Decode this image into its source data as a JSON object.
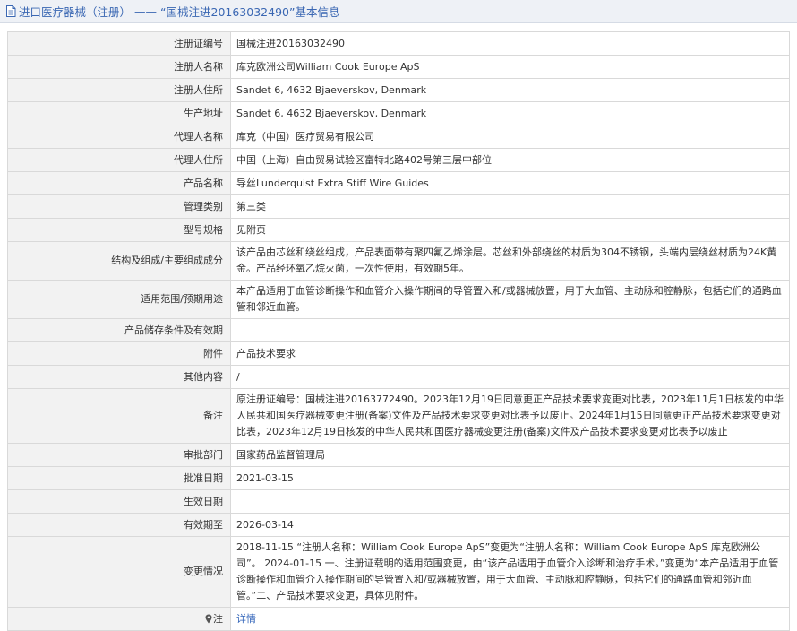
{
  "header": {
    "category": "进口医疗器械（注册）",
    "separator": "——",
    "subject": "“国械注进20163032490”基本信息"
  },
  "rows": [
    {
      "label": "注册证编号",
      "value": "国械注进20163032490"
    },
    {
      "label": "注册人名称",
      "value": "库克欧洲公司William Cook Europe ApS"
    },
    {
      "label": "注册人住所",
      "value": "Sandet 6, 4632 Bjaeverskov, Denmark"
    },
    {
      "label": "生产地址",
      "value": "Sandet 6, 4632 Bjaeverskov, Denmark"
    },
    {
      "label": "代理人名称",
      "value": "库克（中国）医疗贸易有限公司"
    },
    {
      "label": "代理人住所",
      "value": "中国（上海）自由贸易试验区富特北路402号第三层中部位"
    },
    {
      "label": "产品名称",
      "value": "导丝Lunderquist Extra Stiff Wire Guides"
    },
    {
      "label": "管理类别",
      "value": "第三类"
    },
    {
      "label": "型号规格",
      "value": "见附页"
    },
    {
      "label": "结构及组成/主要组成成分",
      "value": "该产品由芯丝和绕丝组成，产品表面带有聚四氟乙烯涂层。芯丝和外部绕丝的材质为304不锈钢，头端内层绕丝材质为24K黄金。产品经环氧乙烷灭菌，一次性使用，有效期5年。"
    },
    {
      "label": "适用范围/预期用途",
      "value": "本产品适用于血管诊断操作和血管介入操作期间的导管置入和/或器械放置，用于大血管、主动脉和腔静脉，包括它们的通路血管和邻近血管。"
    },
    {
      "label": "产品储存条件及有效期",
      "value": ""
    },
    {
      "label": "附件",
      "value": "产品技术要求"
    },
    {
      "label": "其他内容",
      "value": "/"
    },
    {
      "label": "备注",
      "value": "原注册证编号：国械注进20163772490。2023年12月19日同意更正产品技术要求变更对比表，2023年11月1日核发的中华人民共和国医疗器械变更注册(备案)文件及产品技术要求变更对比表予以废止。2024年1月15日同意更正产品技术要求变更对比表，2023年12月19日核发的中华人民共和国医疗器械变更注册(备案)文件及产品技术要求变更对比表予以废止"
    },
    {
      "label": "审批部门",
      "value": "国家药品监督管理局"
    },
    {
      "label": "批准日期",
      "value": "2021-03-15"
    },
    {
      "label": "生效日期",
      "value": ""
    },
    {
      "label": "有效期至",
      "value": "2026-03-14"
    },
    {
      "label": "变更情况",
      "value": "2018-11-15 “注册人名称：William Cook Europe ApS”变更为“注册人名称：William Cook Europe ApS 库克欧洲公司”。 2024-01-15 一、注册证载明的适用范围变更，由“该产品适用于血管介入诊断和治疗手术。”变更为“本产品适用于血管诊断操作和血管介入操作期间的导管置入和/或器械放置，用于大血管、主动脉和腔静脉，包括它们的通路血管和邻近血管。”二、产品技术要求变更，具体见附件。"
    }
  ],
  "note": {
    "label": "注",
    "link": "详情",
    "icon": "pin-icon"
  }
}
